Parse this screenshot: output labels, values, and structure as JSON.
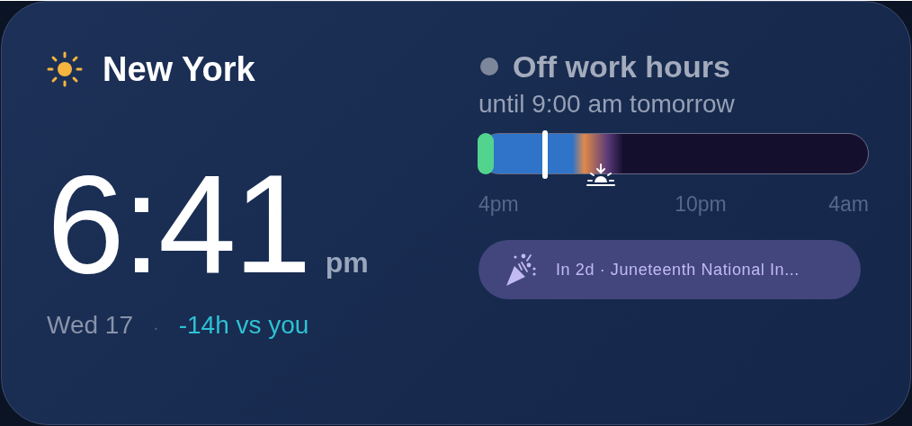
{
  "city": {
    "name": "New York"
  },
  "time": {
    "value": "6:41",
    "meridiem": "pm"
  },
  "date": {
    "day": "Wed 17",
    "separator": "·",
    "offset": "-14h vs you"
  },
  "status": {
    "title": "Off work hours",
    "color": "#7d879b",
    "subtitle": "until 9:00 am tomorrow"
  },
  "timeline": {
    "now": {
      "level": 0.17
    },
    "labels": [
      "4pm",
      "10pm",
      "4am"
    ]
  },
  "event": {
    "text": "In 2d · Juneteenth National In..."
  }
}
